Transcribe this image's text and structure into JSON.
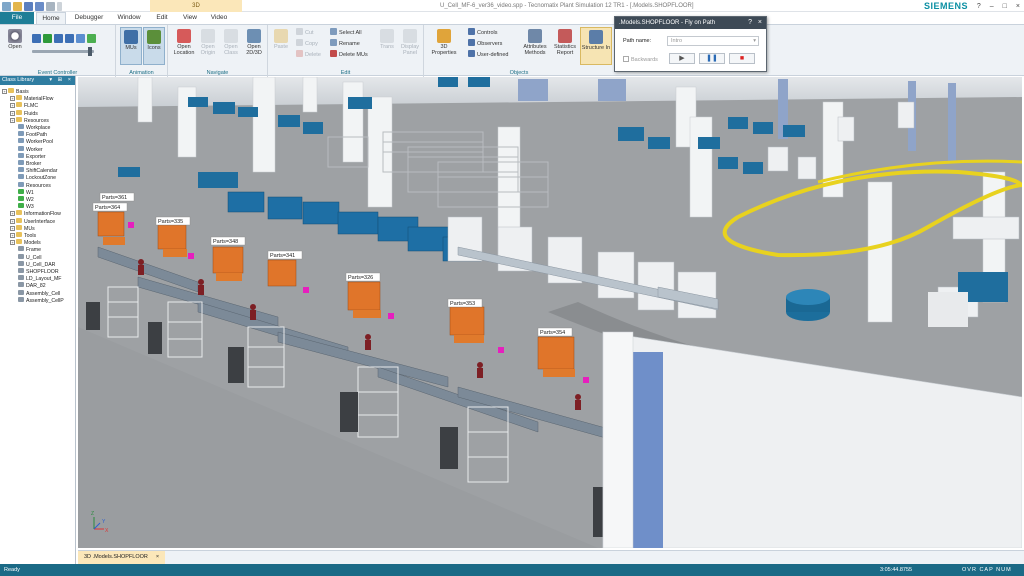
{
  "window": {
    "title": "U_Cell_MF-6_ver36_video.spp - Tecnomatix Plant Simulation 12 TR1 - [.Models.SHOPFLOOR]",
    "context_tab": "3D",
    "brand": "SIEMENS",
    "controls": [
      "?",
      "–",
      "□",
      "×"
    ]
  },
  "tabs": [
    "File",
    "Home",
    "Debugger",
    "Window",
    "Edit",
    "View",
    "Video"
  ],
  "ribbon": {
    "groups": {
      "event_controller": "Event Controller",
      "animation": "Animation",
      "navigate": "Navigate",
      "edit": "Edit",
      "objects": "Objects"
    },
    "open": "Open",
    "mus": "MUs",
    "icons": "Icons",
    "open_location": "Open Location",
    "open_origin": "Open Origin",
    "open_class": "Open Class",
    "open_2d3d": "Open 2D/3D",
    "paste": "Paste",
    "cut": "Cut",
    "copy": "Copy",
    "delete": "Delete",
    "select_all": "Select All",
    "rename": "Rename",
    "delete_mus": "Delete MUs",
    "trans": "Trans",
    "display_panel": "Display Panel",
    "properties_3d": "3D Properties",
    "controls": "Controls",
    "observers": "Observers",
    "user_defined": "User-defined",
    "attributes_methods": "Attributes Methods",
    "statistics_report": "Statistics Report",
    "structure": "Structure In"
  },
  "dialog": {
    "title": ".Models.SHOPFLOOR - Fly on Path",
    "help": "?",
    "close": "×",
    "path_label": "Path name:",
    "path_value": "Intro",
    "backwards": "Backwards",
    "play": "▶",
    "pause": "❚❚",
    "stop": "■"
  },
  "class_library": {
    "title": "Class Library",
    "items": [
      {
        "label": "Basis",
        "level": 0,
        "kind": "expander"
      },
      {
        "label": "MaterialFlow",
        "level": 1,
        "kind": "folder"
      },
      {
        "label": "FLMC",
        "level": 1,
        "kind": "folder"
      },
      {
        "label": "Fluids",
        "level": 1,
        "kind": "folder"
      },
      {
        "label": "Resources",
        "level": 1,
        "kind": "folder"
      },
      {
        "label": "Workplace",
        "level": 2,
        "kind": "object"
      },
      {
        "label": "FootPath",
        "level": 2,
        "kind": "object"
      },
      {
        "label": "WorkerPool",
        "level": 2,
        "kind": "object"
      },
      {
        "label": "Worker",
        "level": 2,
        "kind": "object"
      },
      {
        "label": "Exporter",
        "level": 2,
        "kind": "object"
      },
      {
        "label": "Broker",
        "level": 2,
        "kind": "object"
      },
      {
        "label": "ShiftCalendar",
        "level": 2,
        "kind": "object"
      },
      {
        "label": "LockoutZone",
        "level": 2,
        "kind": "object"
      },
      {
        "label": "Resources",
        "level": 2,
        "kind": "object"
      },
      {
        "label": "W1",
        "level": 2,
        "kind": "green"
      },
      {
        "label": "W2",
        "level": 2,
        "kind": "green"
      },
      {
        "label": "W3",
        "level": 2,
        "kind": "green"
      },
      {
        "label": "InformationFlow",
        "level": 1,
        "kind": "folder"
      },
      {
        "label": "UserInterface",
        "level": 1,
        "kind": "folder"
      },
      {
        "label": "MUs",
        "level": 1,
        "kind": "folder"
      },
      {
        "label": "Tools",
        "level": 1,
        "kind": "folder"
      },
      {
        "label": "Models",
        "level": 1,
        "kind": "folder"
      },
      {
        "label": "Frame",
        "level": 2,
        "kind": "frame"
      },
      {
        "label": "U_Cell",
        "level": 2,
        "kind": "frame"
      },
      {
        "label": "U_Cell_DAR",
        "level": 2,
        "kind": "frame"
      },
      {
        "label": "SHOPFLOOR",
        "level": 2,
        "kind": "frame"
      },
      {
        "label": "LD_Layout_MF",
        "level": 2,
        "kind": "frame"
      },
      {
        "label": "DAR_82",
        "level": 2,
        "kind": "frame"
      },
      {
        "label": "Assembly_Cell",
        "level": 2,
        "kind": "frame"
      },
      {
        "label": "Assembly_CellP",
        "level": 2,
        "kind": "frame"
      }
    ]
  },
  "scene": {
    "part_counters": [
      "Parts=364",
      "Parts=335",
      "Parts=348",
      "Parts=341",
      "Parts=326",
      "Parts=353",
      "Parts=354",
      "Parts=361"
    ],
    "axes": [
      "X",
      "Y",
      "Z"
    ]
  },
  "doc_tab": "3D .Models.SHOPFLOOR",
  "status": {
    "ready": "Ready",
    "time": "3:05:44.8755",
    "keys": "OVR CAP NUM SCRL"
  }
}
